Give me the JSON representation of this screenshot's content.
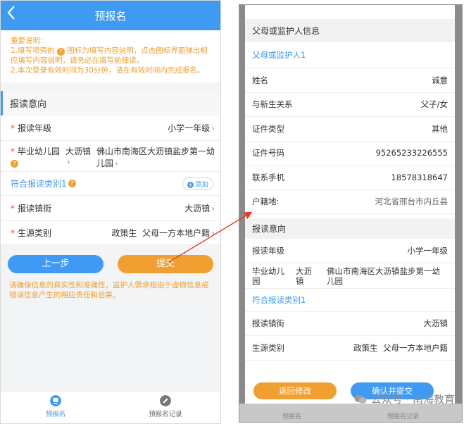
{
  "left": {
    "header": {
      "back_icon": "chevron-left-icon",
      "title": "预报名"
    },
    "notice": {
      "title": "重要说明:",
      "line1a": "1.填写项旁的",
      "line1b": "图标为填写内容说明，点击图标界面弹出相应填写内容说明，请务必在填写前细读。",
      "line2": "2.本次登录有效时间为30分钟，请在有效时间内完成报名。"
    },
    "section_title": "报读意向",
    "rows": {
      "grade_label": "报读年级",
      "grade_value": "小学一年级",
      "kindergarten_label": "毕业幼儿园",
      "kindergarten_town": "大沥镇",
      "kindergarten_name": "佛山市南海区大沥镇盐步第一幼儿园",
      "category_link": "符合报读类别1",
      "add_label": "添加",
      "street_label": "报读镇街",
      "street_value": "大沥镇",
      "source_label": "生源类别",
      "source_value1": "政策生",
      "source_value2": "父母一方本地户籍"
    },
    "buttons": {
      "prev": "上一步",
      "submit": "提交"
    },
    "warning": "请确保信息的真实性和准确性，监护人需承担由于虚假信息或错误信息产生的相应责任和后果。",
    "tabs": [
      {
        "label": "预报名"
      },
      {
        "label": "预报名记录"
      }
    ]
  },
  "right": {
    "guardian_header": "父母或监护人信息",
    "guardian_link": "父母或监护人1",
    "guardian_rows": [
      {
        "label": "姓名",
        "value": "诚意"
      },
      {
        "label": "与新生关系",
        "value": "父子/女"
      },
      {
        "label": "证件类型",
        "value": "其他"
      },
      {
        "label": "证件号码",
        "value": "95265233226555"
      },
      {
        "label": "联系手机",
        "value": "18578318647"
      },
      {
        "label": "户籍地:",
        "value": "河北省邢台市内丘县"
      }
    ],
    "intent_header": "报读意向",
    "grade_label": "报读年级",
    "grade_value": "小学一年级",
    "kindergarten_label": "毕业幼儿园",
    "kindergarten_town": "大沥镇",
    "kindergarten_name": "佛山市南海区大沥镇盐步第一幼儿园",
    "category_link": "符合报读类别1",
    "street_label": "报读镇街",
    "street_value": "大沥镇",
    "source_label": "生源类别",
    "source_value1": "政策生",
    "source_value2": "父母一方本地户籍",
    "buttons": {
      "back": "返回修改",
      "confirm": "确认并提交"
    },
    "watermark": "公众号 · 南海教育",
    "bottom_tabs": [
      "预报名",
      "预报名记录"
    ]
  },
  "colors": {
    "primary": "#3f9af3",
    "accent": "#f0a030",
    "required": "#f0502f"
  }
}
